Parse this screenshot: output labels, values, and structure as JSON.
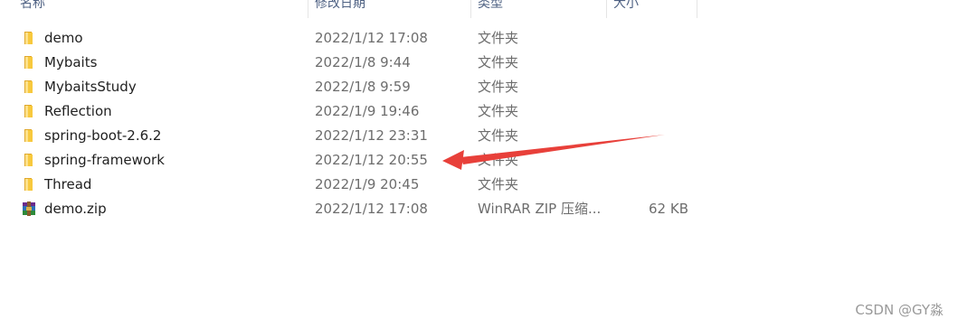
{
  "columns": {
    "name": "名称",
    "date": "修改日期",
    "type": "类型",
    "size": "大小"
  },
  "files": [
    {
      "name": "demo",
      "date": "2022/1/12 17:08",
      "type": "文件夹",
      "size": "",
      "icon": "folder-icon"
    },
    {
      "name": "Mybaits",
      "date": "2022/1/8 9:44",
      "type": "文件夹",
      "size": "",
      "icon": "folder-icon"
    },
    {
      "name": "MybaitsStudy",
      "date": "2022/1/8 9:59",
      "type": "文件夹",
      "size": "",
      "icon": "folder-icon"
    },
    {
      "name": "Reflection",
      "date": "2022/1/9 19:46",
      "type": "文件夹",
      "size": "",
      "icon": "folder-icon"
    },
    {
      "name": "spring-boot-2.6.2",
      "date": "2022/1/12 23:31",
      "type": "文件夹",
      "size": "",
      "icon": "folder-icon"
    },
    {
      "name": "spring-framework",
      "date": "2022/1/12 20:55",
      "type": "文件夹",
      "size": "",
      "icon": "folder-icon"
    },
    {
      "name": "Thread",
      "date": "2022/1/9 20:45",
      "type": "文件夹",
      "size": "",
      "icon": "folder-icon"
    },
    {
      "name": "demo.zip",
      "date": "2022/1/12 17:08",
      "type": "WinRAR ZIP 压缩...",
      "size": "62 KB",
      "icon": "winrar-archive-icon"
    }
  ],
  "watermark": "CSDN @GY淼",
  "colors": {
    "folder": "#f8c93e",
    "arrow": "#e8403a",
    "header_text": "#4d6082",
    "secondary_text": "#6d6d6d"
  }
}
